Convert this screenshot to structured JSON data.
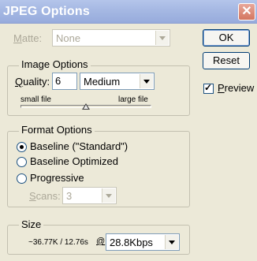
{
  "window": {
    "title": "JPEG Options",
    "close_glyph": "✕"
  },
  "matte": {
    "label_accel": "M",
    "label_rest": "atte:",
    "value": "None"
  },
  "buttons": {
    "ok": "OK",
    "reset": "Reset",
    "preview_label_accel": "P",
    "preview_label_rest": "review",
    "preview_checked": true
  },
  "image_options": {
    "title": "Image Options",
    "quality_label_accel": "Q",
    "quality_label_rest": "uality:",
    "quality_value": "6",
    "quality_preset": "Medium",
    "small_file": "small file",
    "large_file": "large file",
    "slider_level": 0.5
  },
  "format_options": {
    "title": "Format Options",
    "options": [
      {
        "label": "Baseline (\"Standard\")",
        "selected": true
      },
      {
        "label": "Baseline Optimized",
        "selected": false
      },
      {
        "label": "Progressive",
        "selected": false
      }
    ],
    "scans_label_accel": "S",
    "scans_label_rest": "cans:",
    "scans_value": "3"
  },
  "size": {
    "title": "Size",
    "estimate": "~36.77K / 12.76s",
    "at": "@",
    "speed": "28.8Kbps"
  }
}
